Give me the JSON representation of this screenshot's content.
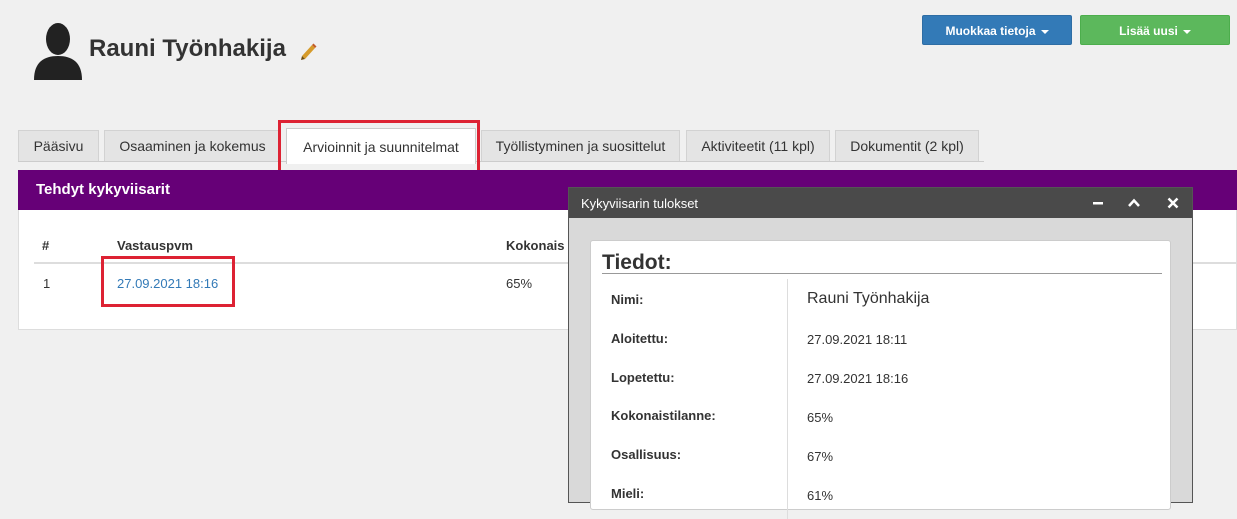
{
  "profile": {
    "name": "Rauni Työnhakija",
    "avatar_icon": "person-silhouette-icon",
    "edit_icon": "pencil-icon"
  },
  "actions": {
    "edit_label": "Muokkaa tietoja",
    "add_label": "Lisää uusi"
  },
  "tabs": [
    {
      "label": "Pääsivu"
    },
    {
      "label": "Osaaminen ja kokemus"
    },
    {
      "label": "Arvioinnit ja suunnitelmat",
      "active": true
    },
    {
      "label": "Työllistyminen ja suosittelut"
    },
    {
      "label": "Aktiviteetit (11 kpl)"
    },
    {
      "label": "Dokumentit (2 kpl)"
    }
  ],
  "section": {
    "title": "Tehdyt kykyviisarit",
    "columns": [
      "#",
      "Vastauspvm",
      "Kokonais"
    ],
    "rows": [
      {
        "index": "1",
        "date": "27.09.2021 18:16",
        "total": "65%"
      }
    ]
  },
  "modal": {
    "title": "Kykyviisarin tulokset",
    "panel_title": "Tiedot:",
    "fields": [
      {
        "label": "Nimi:",
        "value": "Rauni Työnhakija"
      },
      {
        "label": "Aloitettu:",
        "value": "27.09.2021 18:11"
      },
      {
        "label": "Lopetettu:",
        "value": "27.09.2021 18:16"
      },
      {
        "label": "Kokonaistilanne:",
        "value": "65%"
      },
      {
        "label": "Osallisuus:",
        "value": "67%"
      },
      {
        "label": "Mieli:",
        "value": "61%"
      }
    ]
  },
  "colors": {
    "accent_purple": "#660077",
    "primary_blue": "#337ab7",
    "success_green": "#5cb85c",
    "highlight_red": "#dd2233"
  }
}
